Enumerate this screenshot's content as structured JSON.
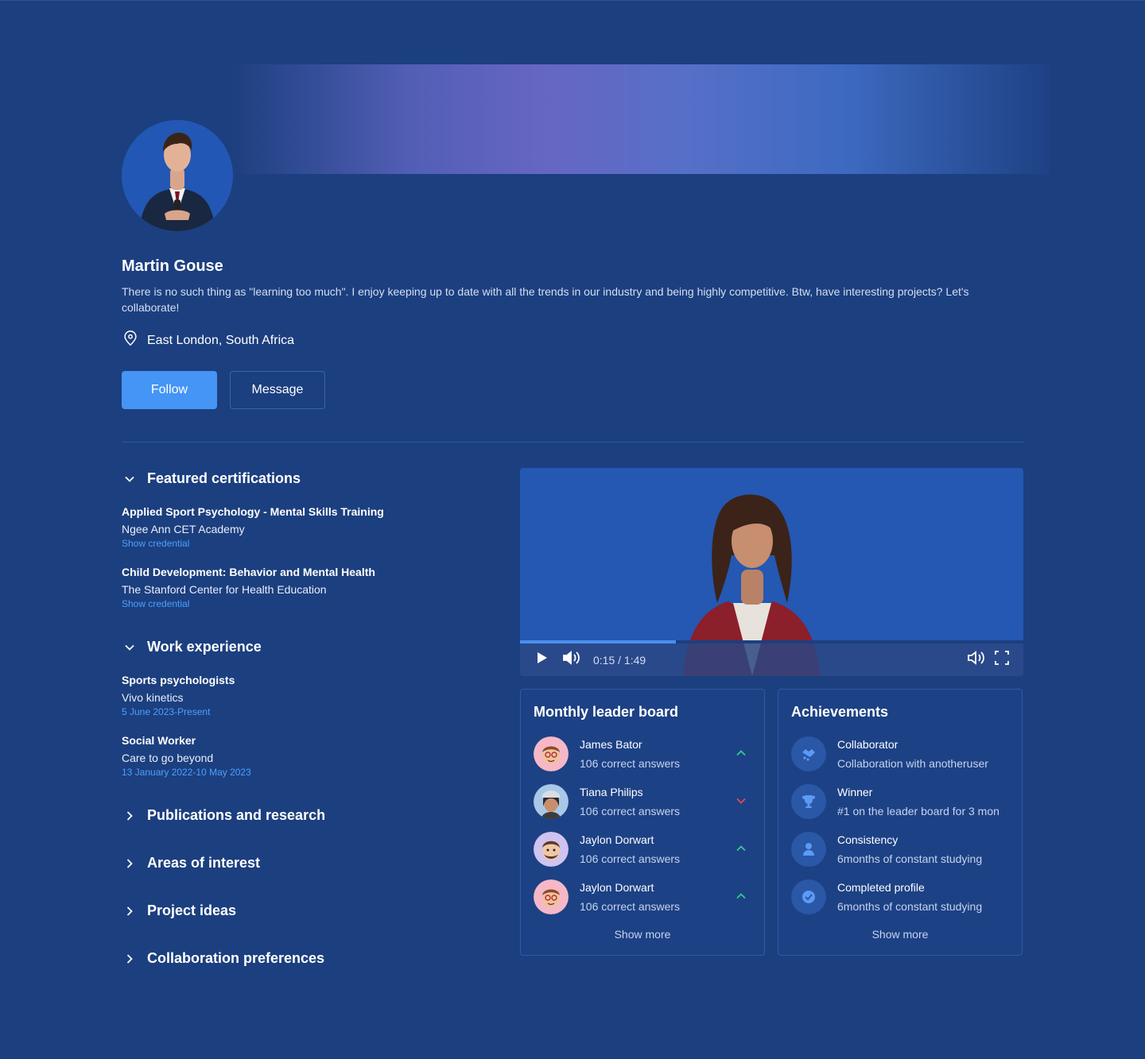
{
  "profile": {
    "name": "Martin Gouse",
    "bio": "There is no such thing as \"learning too much\". I enjoy keeping up to date with all the trends in our industry and being highly competitive. Btw, have interesting projects? Let's collaborate!",
    "location": "East London, South Africa",
    "follow_label": "Follow",
    "message_label": "Message"
  },
  "certifications": {
    "title": "Featured certifications",
    "items": [
      {
        "title": "Applied Sport Psychology - Mental Skills Training",
        "org": "Ngee Ann CET Academy",
        "link": "Show credential"
      },
      {
        "title": "Child Development: Behavior and Mental Health",
        "org": "The Stanford Center for Health Education",
        "link": "Show credential"
      }
    ]
  },
  "work": {
    "title": "Work experience",
    "items": [
      {
        "title": "Sports psychologists",
        "org": "Vivo kinetics",
        "dates": "5 June 2023-Present"
      },
      {
        "title": "Social Worker",
        "org": "Care to go beyond",
        "dates": "13 January 2022-10 May 2023"
      }
    ]
  },
  "collapsed_sections": [
    "Publications and research",
    "Areas of interest",
    "Project ideas",
    "Collaboration preferences"
  ],
  "video": {
    "time": "0:15 / 1:49",
    "progress": 0.31
  },
  "leaderboard": {
    "title": "Monthly leader board",
    "rows": [
      {
        "name": "James Bator",
        "score": "106 correct answers",
        "trend": "up"
      },
      {
        "name": "Tiana Philips",
        "score": "106 correct answers",
        "trend": "down"
      },
      {
        "name": "Jaylon Dorwart",
        "score": "106 correct answers",
        "trend": "up"
      },
      {
        "name": "Jaylon Dorwart",
        "score": "106 correct answers",
        "trend": "up"
      }
    ],
    "show_more": "Show more"
  },
  "achievements": {
    "title": "Achievements",
    "rows": [
      {
        "name": "Collaborator",
        "desc": "Collaboration with anotheruser",
        "icon": "handshake-icon"
      },
      {
        "name": "Winner",
        "desc": "#1 on the leader board for 3 mon",
        "icon": "trophy-icon"
      },
      {
        "name": "Consistency",
        "desc": "6months of constant studying",
        "icon": "user-icon"
      },
      {
        "name": "Completed profile",
        "desc": "6months of constant studying",
        "icon": "check-badge-icon"
      }
    ],
    "show_more": "Show more"
  },
  "colors": {
    "background": "#1c3f7f",
    "accent": "#4495f5",
    "link": "#4aa0ff",
    "trend_up": "#2fcf8a",
    "trend_down": "#e5484d"
  }
}
